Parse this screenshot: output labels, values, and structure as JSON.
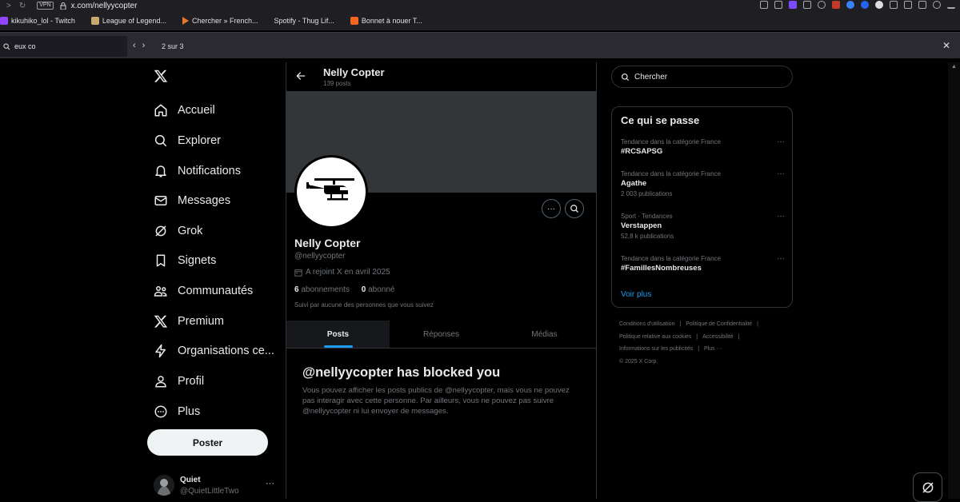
{
  "browser": {
    "vpn_label": "VPN",
    "url": "x.com/nellyycopter",
    "bookmarks": [
      {
        "label": "kikuhiko_lol - Twitch",
        "color": "#9146ff"
      },
      {
        "label": "League of Legend...",
        "color": "#c8aa6e"
      },
      {
        "label": "Chercher » French...",
        "color": "#e8762b"
      },
      {
        "label": "Spotify - Thug Lif...",
        "color": "#1db954"
      },
      {
        "label": "Bonnet à nouer T...",
        "color": "#f16521"
      }
    ]
  },
  "findbar": {
    "value": "eux co",
    "count": "2 sur 3"
  },
  "sidebar": {
    "items": [
      {
        "label": "Accueil",
        "icon": "home-icon"
      },
      {
        "label": "Explorer",
        "icon": "search-icon"
      },
      {
        "label": "Notifications",
        "icon": "bell-icon"
      },
      {
        "label": "Messages",
        "icon": "mail-icon"
      },
      {
        "label": "Grok",
        "icon": "grok-icon"
      },
      {
        "label": "Signets",
        "icon": "bookmark-icon"
      },
      {
        "label": "Communautés",
        "icon": "people-icon"
      },
      {
        "label": "Premium",
        "icon": "x-logo-icon"
      },
      {
        "label": "Organisations ce...",
        "icon": "lightning-icon"
      },
      {
        "label": "Profil",
        "icon": "person-icon"
      },
      {
        "label": "Plus",
        "icon": "more-circle-icon"
      }
    ],
    "post_label": "Poster",
    "account": {
      "name": "Quiet",
      "handle": "@QuietLittleTwo"
    }
  },
  "profile": {
    "header_name": "Nelly Copter",
    "header_posts": "139 posts",
    "name": "Nelly Copter",
    "handle": "@nellyycopter",
    "joined": "A rejoint X en avril 2025",
    "following_count": "6",
    "following_label": "abonnements",
    "followers_count": "0",
    "followers_label": "abonné",
    "followed_by": "Suivi par aucune des personnes que vous suivez",
    "tabs": [
      "Posts",
      "Réponses",
      "Médias"
    ],
    "blocked_title": "@nellyycopter has blocked you",
    "blocked_text": "Vous pouvez afficher les posts publics de @nellyycopter, mais vous ne pouvez pas interagir avec cette personne. Par ailleurs, vous ne pouvez pas suivre @nellyycopter ni lui envoyer de messages."
  },
  "right": {
    "search_placeholder": "Chercher",
    "trends_title": "Ce qui se passe",
    "trends": [
      {
        "context": "Tendance dans la catégorie France",
        "title": "#RCSAPSG",
        "count": ""
      },
      {
        "context": "Tendance dans la catégorie France",
        "title": "Agathe",
        "count": "2 003 publications"
      },
      {
        "context": "Sport · Tendances",
        "title": "Verstappen",
        "count": "52,8 k publications"
      },
      {
        "context": "Tendance dans la catégorie France",
        "title": "#FamillesNombreuses",
        "count": ""
      }
    ],
    "show_more": "Voir plus",
    "footer": {
      "terms": "Conditions d'utilisation",
      "privacy": "Politique de Confidentialité",
      "cookies": "Politique relative aux cookies",
      "accessibility": "Accessibilité",
      "ads": "Informations sur les publicités",
      "more": "Plus ···",
      "copyright": "© 2025 X Corp."
    }
  }
}
